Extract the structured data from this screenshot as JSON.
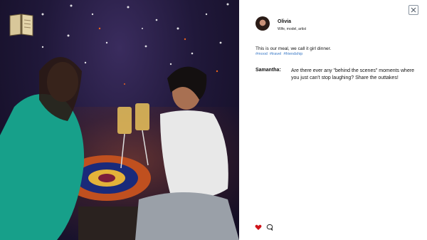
{
  "post": {
    "username": "Olivia",
    "bio": "Wife, model, artist",
    "caption": "This is our meal, we call it girl dinner.",
    "tags": [
      "#mood",
      "#travel",
      "#friendship"
    ],
    "comment": {
      "author": "Samantha:",
      "text": "Are there ever any \"behind the scenes\" moments where you just can't stop laughing? Share the outtakes!"
    }
  },
  "icons": {
    "close": "close-icon",
    "like": "heart-icon",
    "comment": "comment-icon",
    "journal": "journal-icon"
  },
  "colors": {
    "like": "#d0141a",
    "tag": "#3a79c6"
  }
}
